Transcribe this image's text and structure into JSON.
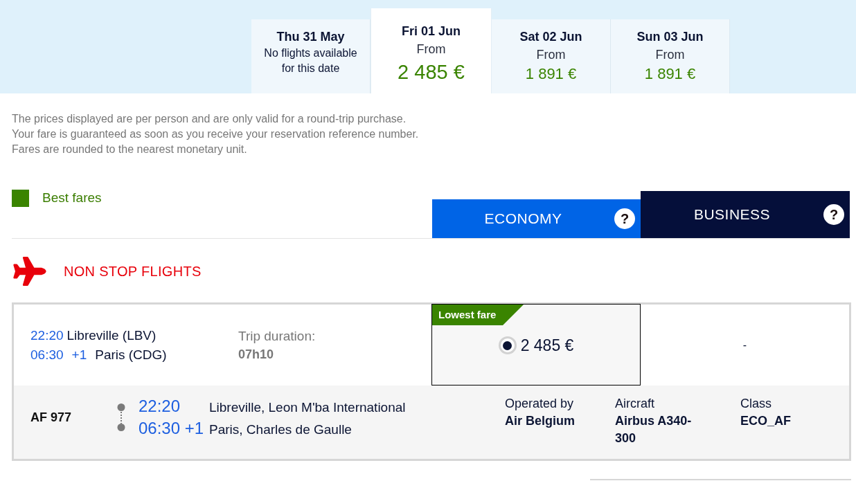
{
  "date_tabs": [
    {
      "day": "Thu 31 May",
      "note": "No flights available for this date",
      "selected": false
    },
    {
      "day": "Fri 01 Jun",
      "from": "From",
      "price": "2 485 €",
      "selected": true
    },
    {
      "day": "Sat 02 Jun",
      "from": "From",
      "price": "1 891 €",
      "selected": false
    },
    {
      "day": "Sun 03 Jun",
      "from": "From",
      "price": "1 891 €",
      "selected": false
    }
  ],
  "notes": [
    "The prices displayed are per person and are only valid for a round-trip purchase.",
    "Your fare is guaranteed as soon as you receive your reservation reference number.",
    "Fares are rounded to the nearest monetary unit."
  ],
  "legend": {
    "label": "Best fares"
  },
  "fare_classes": [
    {
      "kind": "economy",
      "label": "ECONOMY",
      "help": "?"
    },
    {
      "kind": "business",
      "label": "BUSINESS",
      "help": "?"
    }
  ],
  "section": {
    "title": "NON STOP FLIGHTS"
  },
  "flight": {
    "departure_time": "22:20",
    "departure_city": "Libreville (LBV)",
    "arrival_time": "06:30",
    "day_offset": "+1",
    "arrival_city": "Paris (CDG)",
    "duration_label": "Trip duration:",
    "duration": "07h10",
    "fares": [
      {
        "kind": "price",
        "badge": "Lowest fare",
        "price": "2 485 €",
        "selected": true
      },
      {
        "kind": "none",
        "text": "-"
      }
    ],
    "segments": [
      {
        "flight_number": "AF 977",
        "departure_time": "22:20",
        "arrival_time": "06:30 +1",
        "departure_airport": "Libreville, Leon M'ba International",
        "arrival_airport": "Paris, Charles de Gaulle",
        "operated_by_label": "Operated by",
        "operator": "Air Belgium",
        "aircraft_label": "Aircraft",
        "aircraft": "Airbus A340-300",
        "class_label": "Class",
        "class": "ECO_AF"
      }
    ]
  }
}
